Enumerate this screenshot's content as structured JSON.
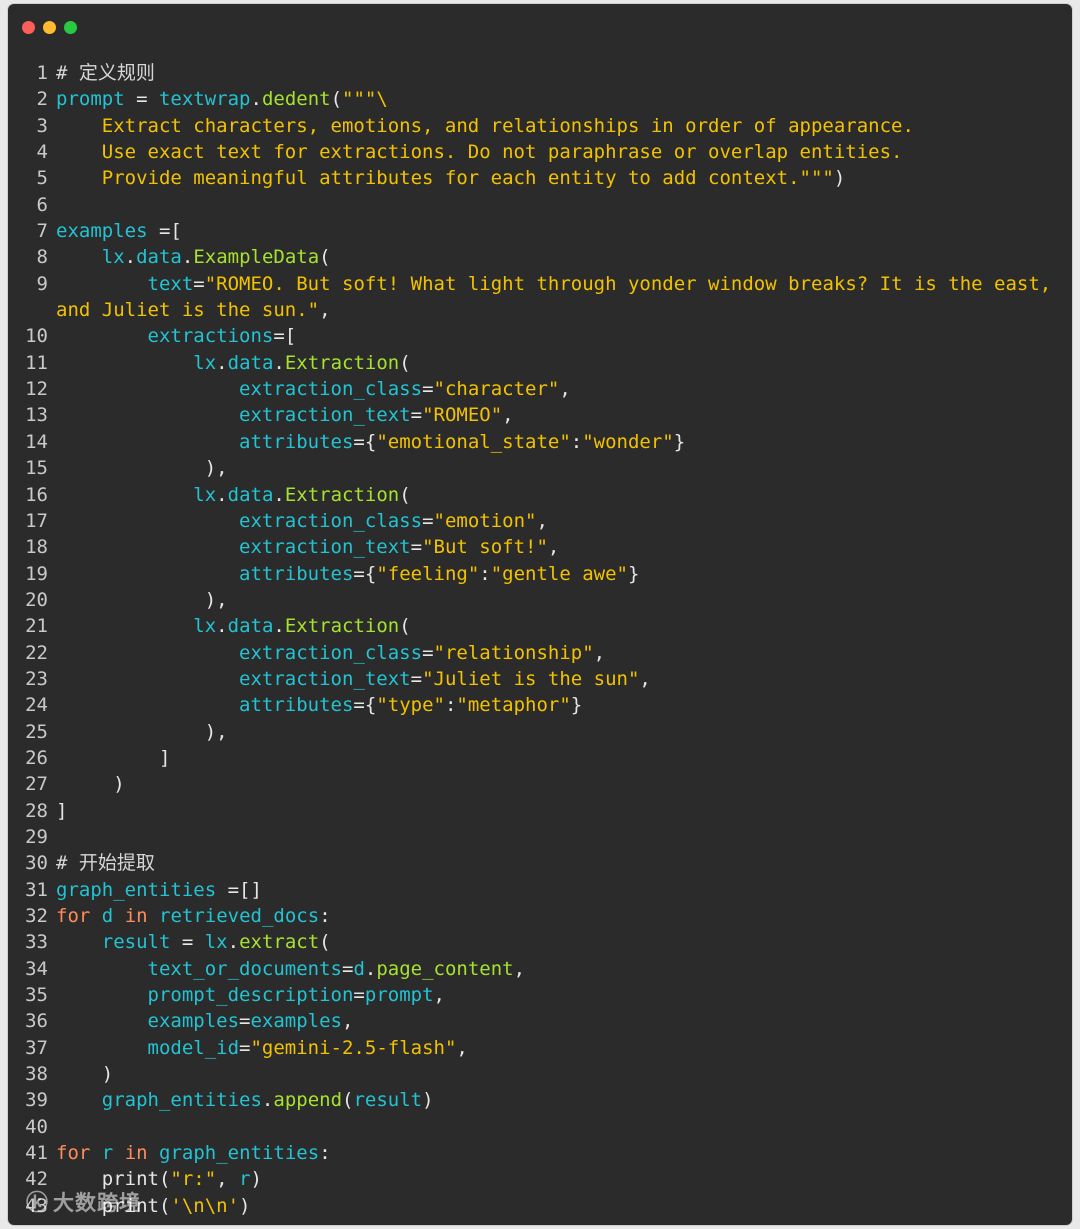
{
  "window": {
    "controls": [
      {
        "name": "close",
        "color": "#fe5f57"
      },
      {
        "name": "minimize",
        "color": "#febc2e"
      },
      {
        "name": "maximize",
        "color": "#28c840"
      }
    ]
  },
  "colors": {
    "default": "#e6e6e6",
    "var": "#22c3d3",
    "call": "#a6e22e",
    "string": "#f2c200",
    "keyword": "#ff8c5a",
    "comment": "#d6d6d6",
    "lineno": "#c9c9c9"
  },
  "code_lines": [
    {
      "n": "1",
      "tokens": [
        {
          "t": "# 定义规则",
          "c": "comment"
        }
      ]
    },
    {
      "n": "2",
      "tokens": [
        {
          "t": "prompt",
          "c": "var"
        },
        {
          "t": " = ",
          "c": "default"
        },
        {
          "t": "textwrap",
          "c": "var"
        },
        {
          "t": ".",
          "c": "default"
        },
        {
          "t": "dedent",
          "c": "call"
        },
        {
          "t": "(",
          "c": "default"
        },
        {
          "t": "\"\"\"\\",
          "c": "string"
        }
      ]
    },
    {
      "n": "3",
      "tokens": [
        {
          "t": "    Extract characters, emotions, and relationships in order of appearance.",
          "c": "string"
        }
      ]
    },
    {
      "n": "4",
      "tokens": [
        {
          "t": "    Use exact text for extractions. Do not paraphrase or overlap entities.",
          "c": "string"
        }
      ]
    },
    {
      "n": "5",
      "tokens": [
        {
          "t": "    Provide meaningful attributes for each entity to add context.\"\"\"",
          "c": "string"
        },
        {
          "t": ")",
          "c": "default"
        }
      ]
    },
    {
      "n": "6",
      "tokens": []
    },
    {
      "n": "7",
      "tokens": [
        {
          "t": "examples",
          "c": "var"
        },
        {
          "t": " =[",
          "c": "default"
        }
      ]
    },
    {
      "n": "8",
      "tokens": [
        {
          "t": "    ",
          "c": "default"
        },
        {
          "t": "lx",
          "c": "var"
        },
        {
          "t": ".",
          "c": "default"
        },
        {
          "t": "data",
          "c": "var"
        },
        {
          "t": ".",
          "c": "default"
        },
        {
          "t": "ExampleData",
          "c": "call"
        },
        {
          "t": "(",
          "c": "default"
        }
      ]
    },
    {
      "n": "9",
      "tokens": [
        {
          "t": "        ",
          "c": "default"
        },
        {
          "t": "text",
          "c": "var"
        },
        {
          "t": "=",
          "c": "default"
        },
        {
          "t": "\"ROMEO. But soft! What light through yonder window breaks? It is the east,",
          "c": "string"
        }
      ],
      "wrap": [
        {
          "t": "and Juliet is the sun.\"",
          "c": "string"
        },
        {
          "t": ",",
          "c": "default"
        }
      ]
    },
    {
      "n": "10",
      "tokens": [
        {
          "t": "        ",
          "c": "default"
        },
        {
          "t": "extractions",
          "c": "var"
        },
        {
          "t": "=[",
          "c": "default"
        }
      ]
    },
    {
      "n": "11",
      "tokens": [
        {
          "t": "            ",
          "c": "default"
        },
        {
          "t": "lx",
          "c": "var"
        },
        {
          "t": ".",
          "c": "default"
        },
        {
          "t": "data",
          "c": "var"
        },
        {
          "t": ".",
          "c": "default"
        },
        {
          "t": "Extraction",
          "c": "call"
        },
        {
          "t": "(",
          "c": "default"
        }
      ]
    },
    {
      "n": "12",
      "tokens": [
        {
          "t": "                ",
          "c": "default"
        },
        {
          "t": "extraction_class",
          "c": "var"
        },
        {
          "t": "=",
          "c": "default"
        },
        {
          "t": "\"character\"",
          "c": "string"
        },
        {
          "t": ",",
          "c": "default"
        }
      ]
    },
    {
      "n": "13",
      "tokens": [
        {
          "t": "                ",
          "c": "default"
        },
        {
          "t": "extraction_text",
          "c": "var"
        },
        {
          "t": "=",
          "c": "default"
        },
        {
          "t": "\"ROMEO\"",
          "c": "string"
        },
        {
          "t": ",",
          "c": "default"
        }
      ]
    },
    {
      "n": "14",
      "tokens": [
        {
          "t": "                ",
          "c": "default"
        },
        {
          "t": "attributes",
          "c": "var"
        },
        {
          "t": "={",
          "c": "default"
        },
        {
          "t": "\"emotional_state\"",
          "c": "string"
        },
        {
          "t": ":",
          "c": "default"
        },
        {
          "t": "\"wonder\"",
          "c": "string"
        },
        {
          "t": "}",
          "c": "default"
        }
      ]
    },
    {
      "n": "15",
      "tokens": [
        {
          "t": "             ),",
          "c": "default"
        }
      ]
    },
    {
      "n": "16",
      "tokens": [
        {
          "t": "            ",
          "c": "default"
        },
        {
          "t": "lx",
          "c": "var"
        },
        {
          "t": ".",
          "c": "default"
        },
        {
          "t": "data",
          "c": "var"
        },
        {
          "t": ".",
          "c": "default"
        },
        {
          "t": "Extraction",
          "c": "call"
        },
        {
          "t": "(",
          "c": "default"
        }
      ]
    },
    {
      "n": "17",
      "tokens": [
        {
          "t": "                ",
          "c": "default"
        },
        {
          "t": "extraction_class",
          "c": "var"
        },
        {
          "t": "=",
          "c": "default"
        },
        {
          "t": "\"emotion\"",
          "c": "string"
        },
        {
          "t": ",",
          "c": "default"
        }
      ]
    },
    {
      "n": "18",
      "tokens": [
        {
          "t": "                ",
          "c": "default"
        },
        {
          "t": "extraction_text",
          "c": "var"
        },
        {
          "t": "=",
          "c": "default"
        },
        {
          "t": "\"But soft!\"",
          "c": "string"
        },
        {
          "t": ",",
          "c": "default"
        }
      ]
    },
    {
      "n": "19",
      "tokens": [
        {
          "t": "                ",
          "c": "default"
        },
        {
          "t": "attributes",
          "c": "var"
        },
        {
          "t": "={",
          "c": "default"
        },
        {
          "t": "\"feeling\"",
          "c": "string"
        },
        {
          "t": ":",
          "c": "default"
        },
        {
          "t": "\"gentle awe\"",
          "c": "string"
        },
        {
          "t": "}",
          "c": "default"
        }
      ]
    },
    {
      "n": "20",
      "tokens": [
        {
          "t": "             ),",
          "c": "default"
        }
      ]
    },
    {
      "n": "21",
      "tokens": [
        {
          "t": "            ",
          "c": "default"
        },
        {
          "t": "lx",
          "c": "var"
        },
        {
          "t": ".",
          "c": "default"
        },
        {
          "t": "data",
          "c": "var"
        },
        {
          "t": ".",
          "c": "default"
        },
        {
          "t": "Extraction",
          "c": "call"
        },
        {
          "t": "(",
          "c": "default"
        }
      ]
    },
    {
      "n": "22",
      "tokens": [
        {
          "t": "                ",
          "c": "default"
        },
        {
          "t": "extraction_class",
          "c": "var"
        },
        {
          "t": "=",
          "c": "default"
        },
        {
          "t": "\"relationship\"",
          "c": "string"
        },
        {
          "t": ",",
          "c": "default"
        }
      ]
    },
    {
      "n": "23",
      "tokens": [
        {
          "t": "                ",
          "c": "default"
        },
        {
          "t": "extraction_text",
          "c": "var"
        },
        {
          "t": "=",
          "c": "default"
        },
        {
          "t": "\"Juliet is the sun\"",
          "c": "string"
        },
        {
          "t": ",",
          "c": "default"
        }
      ]
    },
    {
      "n": "24",
      "tokens": [
        {
          "t": "                ",
          "c": "default"
        },
        {
          "t": "attributes",
          "c": "var"
        },
        {
          "t": "={",
          "c": "default"
        },
        {
          "t": "\"type\"",
          "c": "string"
        },
        {
          "t": ":",
          "c": "default"
        },
        {
          "t": "\"metaphor\"",
          "c": "string"
        },
        {
          "t": "}",
          "c": "default"
        }
      ]
    },
    {
      "n": "25",
      "tokens": [
        {
          "t": "             ),",
          "c": "default"
        }
      ]
    },
    {
      "n": "26",
      "tokens": [
        {
          "t": "         ]",
          "c": "default"
        }
      ]
    },
    {
      "n": "27",
      "tokens": [
        {
          "t": "     )",
          "c": "default"
        }
      ]
    },
    {
      "n": "28",
      "tokens": [
        {
          "t": "]",
          "c": "default"
        }
      ]
    },
    {
      "n": "29",
      "tokens": []
    },
    {
      "n": "30",
      "tokens": [
        {
          "t": "# 开始提取",
          "c": "comment"
        }
      ]
    },
    {
      "n": "31",
      "tokens": [
        {
          "t": "graph_entities",
          "c": "var"
        },
        {
          "t": " =[]",
          "c": "default"
        }
      ]
    },
    {
      "n": "32",
      "tokens": [
        {
          "t": "for",
          "c": "keyword"
        },
        {
          "t": " ",
          "c": "default"
        },
        {
          "t": "d",
          "c": "var"
        },
        {
          "t": " ",
          "c": "default"
        },
        {
          "t": "in",
          "c": "keyword"
        },
        {
          "t": " ",
          "c": "default"
        },
        {
          "t": "retrieved_docs",
          "c": "var"
        },
        {
          "t": ":",
          "c": "default"
        }
      ]
    },
    {
      "n": "33",
      "tokens": [
        {
          "t": "    ",
          "c": "default"
        },
        {
          "t": "result",
          "c": "var"
        },
        {
          "t": " = ",
          "c": "default"
        },
        {
          "t": "lx",
          "c": "var"
        },
        {
          "t": ".",
          "c": "default"
        },
        {
          "t": "extract",
          "c": "call"
        },
        {
          "t": "(",
          "c": "default"
        }
      ]
    },
    {
      "n": "34",
      "tokens": [
        {
          "t": "        ",
          "c": "default"
        },
        {
          "t": "text_or_documents",
          "c": "var"
        },
        {
          "t": "=",
          "c": "default"
        },
        {
          "t": "d",
          "c": "var"
        },
        {
          "t": ".",
          "c": "default"
        },
        {
          "t": "page_content",
          "c": "call"
        },
        {
          "t": ",",
          "c": "default"
        }
      ]
    },
    {
      "n": "35",
      "tokens": [
        {
          "t": "        ",
          "c": "default"
        },
        {
          "t": "prompt_description",
          "c": "var"
        },
        {
          "t": "=",
          "c": "default"
        },
        {
          "t": "prompt",
          "c": "var"
        },
        {
          "t": ",",
          "c": "default"
        }
      ]
    },
    {
      "n": "36",
      "tokens": [
        {
          "t": "        ",
          "c": "default"
        },
        {
          "t": "examples",
          "c": "var"
        },
        {
          "t": "=",
          "c": "default"
        },
        {
          "t": "examples",
          "c": "var"
        },
        {
          "t": ",",
          "c": "default"
        }
      ]
    },
    {
      "n": "37",
      "tokens": [
        {
          "t": "        ",
          "c": "default"
        },
        {
          "t": "model_id",
          "c": "var"
        },
        {
          "t": "=",
          "c": "default"
        },
        {
          "t": "\"gemini-2.5-flash\"",
          "c": "string"
        },
        {
          "t": ",",
          "c": "default"
        }
      ]
    },
    {
      "n": "38",
      "tokens": [
        {
          "t": "    )",
          "c": "default"
        }
      ]
    },
    {
      "n": "39",
      "tokens": [
        {
          "t": "    ",
          "c": "default"
        },
        {
          "t": "graph_entities",
          "c": "var"
        },
        {
          "t": ".",
          "c": "default"
        },
        {
          "t": "append",
          "c": "call"
        },
        {
          "t": "(",
          "c": "default"
        },
        {
          "t": "result",
          "c": "var"
        },
        {
          "t": ")",
          "c": "default"
        }
      ]
    },
    {
      "n": "40",
      "tokens": []
    },
    {
      "n": "41",
      "tokens": [
        {
          "t": "for",
          "c": "keyword"
        },
        {
          "t": " ",
          "c": "default"
        },
        {
          "t": "r",
          "c": "var"
        },
        {
          "t": " ",
          "c": "default"
        },
        {
          "t": "in",
          "c": "keyword"
        },
        {
          "t": " ",
          "c": "default"
        },
        {
          "t": "graph_entities",
          "c": "var"
        },
        {
          "t": ":",
          "c": "default"
        }
      ]
    },
    {
      "n": "42",
      "tokens": [
        {
          "t": "    print(",
          "c": "default"
        },
        {
          "t": "\"r:\"",
          "c": "string"
        },
        {
          "t": ", ",
          "c": "default"
        },
        {
          "t": "r",
          "c": "var"
        },
        {
          "t": ")",
          "c": "default"
        }
      ]
    },
    {
      "n": "43",
      "tokens": [
        {
          "t": "    print(",
          "c": "default"
        },
        {
          "t": "'\\n\\n'",
          "c": "string"
        },
        {
          "t": ")",
          "c": "default"
        }
      ]
    }
  ],
  "watermark": {
    "mark": "ⓚ",
    "text": "大数跨境"
  }
}
